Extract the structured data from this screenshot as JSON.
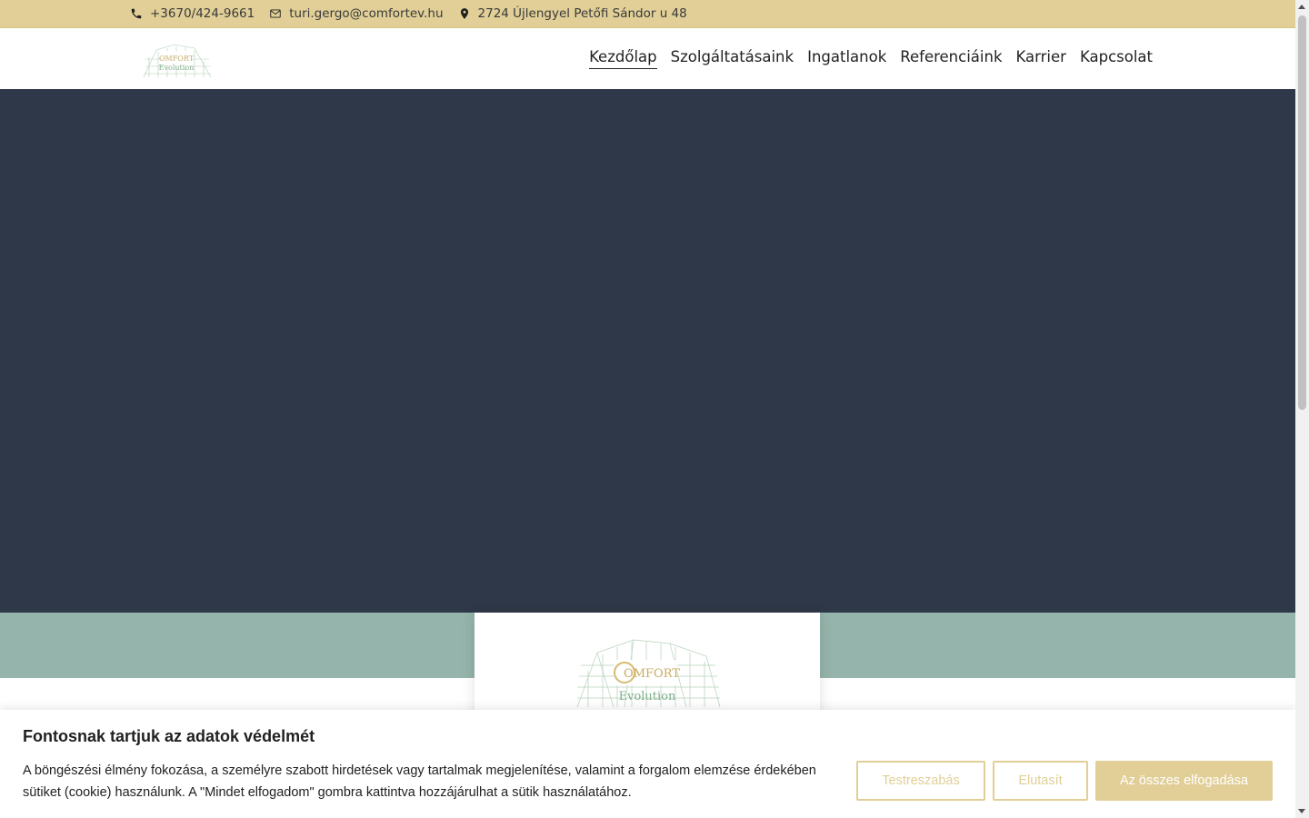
{
  "topbar": {
    "phone": "+3670/424-9661",
    "email": "turi.gergo@comfortev.hu",
    "address": "2724 Újlengyel Petőfi Sándor u 48",
    "phone_icon": "phone-icon",
    "email_icon": "envelope-icon",
    "address_icon": "map-pin-icon"
  },
  "header": {
    "logo_text_top": "OMFORT",
    "logo_text_bottom": "Evolution",
    "nav": [
      {
        "label": "Kezdőlap",
        "active": true
      },
      {
        "label": "Szolgáltatásaink",
        "active": false
      },
      {
        "label": "Ingatlanok",
        "active": false
      },
      {
        "label": "Referenciáink",
        "active": false
      },
      {
        "label": "Karrier",
        "active": false
      },
      {
        "label": "Kapcsolat",
        "active": false
      }
    ]
  },
  "logo_card": {
    "text_top": "OMFORT",
    "text_bottom": "Evolution"
  },
  "cookie": {
    "title": "Fontosnak tartjuk az adatok védelmét",
    "text": "A böngészési élmény fokozása, a személyre szabott hirdetések vagy tartalmak megjelenítése, valamint a forgalom elemzése érdekében sütiket (cookie) használunk. A \"Mindet elfogadom\" gombra kattintva hozzájárulhat a sütik használatához.",
    "customize_label": "Testreszabás",
    "reject_label": "Elutasít",
    "accept_label": "Az összes elfogadása"
  },
  "colors": {
    "accent_gold": "#e1cf97",
    "hero_dark": "#2f3848",
    "band_green": "#95b4ab"
  }
}
